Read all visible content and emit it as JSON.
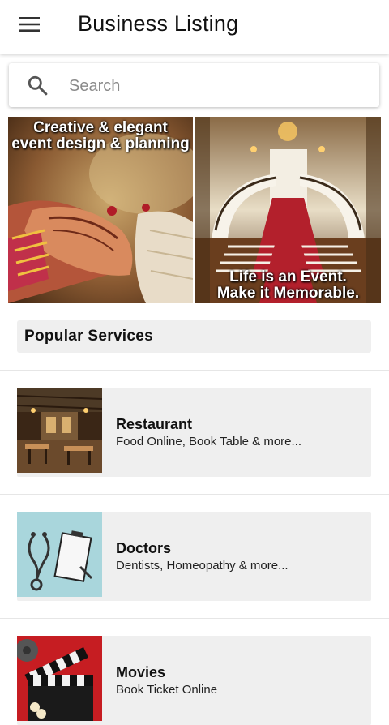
{
  "appbar": {
    "title": "Business Listing",
    "menu_icon": "hamburger-menu-icon"
  },
  "search": {
    "placeholder": "Search",
    "value": "",
    "icon": "search-icon"
  },
  "banners": [
    {
      "caption": "Creative & elegant event design & planning"
    },
    {
      "caption_line1": "Life is an Event.",
      "caption_line2": "Make it Memorable."
    }
  ],
  "popular": {
    "heading": "Popular Services",
    "items": [
      {
        "title": "Restaurant",
        "subtitle": "Food Online, Book Table & more..."
      },
      {
        "title": "Doctors",
        "subtitle": "Dentists, Homeopathy & more..."
      },
      {
        "title": "Movies",
        "subtitle": "Book Ticket Online"
      }
    ]
  },
  "colors": {
    "card_bg": "#efefef",
    "red_carpet": "#b3202c",
    "wood": "#7a4a24"
  }
}
